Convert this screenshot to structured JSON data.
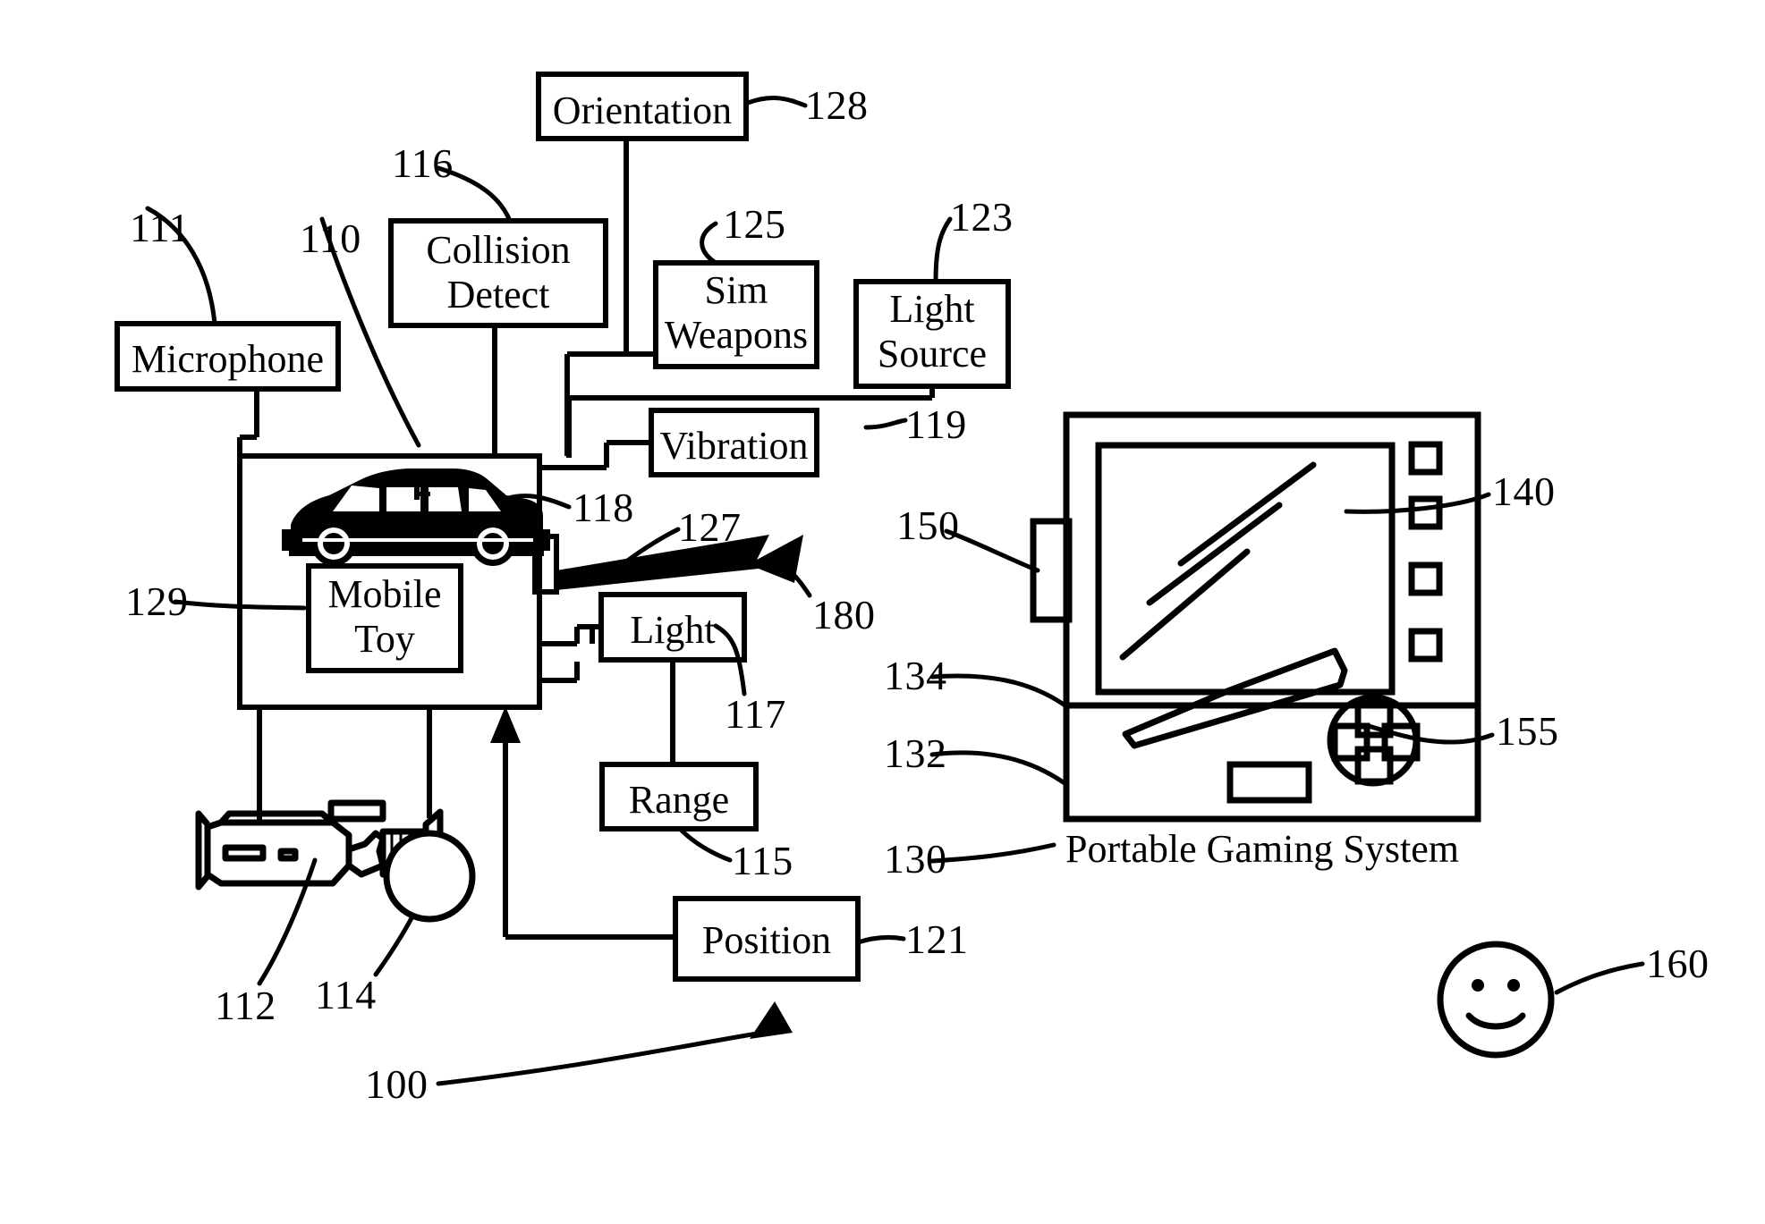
{
  "figure": {
    "title": "Mobile Toy and Portable Gaming System block diagram",
    "system_ref": "100",
    "caption": "Portable Gaming System",
    "line_color": "#000000",
    "background_color": "#ffffff"
  },
  "blocks": {
    "orientation": {
      "label": "Orientation",
      "ref": "128"
    },
    "collision_detect": {
      "label_line1": "Collision",
      "label_line2": "Detect",
      "ref": "116"
    },
    "sim_weapons": {
      "label_line1": "Sim",
      "label_line2": "Weapons",
      "ref": "125"
    },
    "light_source": {
      "label_line1": "Light",
      "label_line2": "Source",
      "ref": "123"
    },
    "microphone": {
      "label": "Microphone",
      "ref": "111"
    },
    "vibration": {
      "label": "Vibration",
      "ref": "119"
    },
    "light": {
      "label": "Light",
      "ref": "117"
    },
    "range": {
      "label": "Range",
      "ref": "115"
    },
    "position": {
      "label": "Position",
      "ref": "121"
    },
    "mobile_toy": {
      "label_line1": "Mobile",
      "label_line2": "Toy",
      "ref": "129"
    },
    "toy_enclosure": {
      "ref": "110"
    },
    "toy_transceiver": {
      "ref": "127"
    },
    "toy_car_icon": {
      "ref": "118"
    },
    "camera": {
      "ref": "112"
    },
    "speaker_sound": {
      "ref": "114"
    },
    "wireless_link": {
      "ref": "180"
    },
    "gaming_transceiver": {
      "ref": "150"
    },
    "gaming_buttons": {
      "ref": "140"
    },
    "gaming_dpad": {
      "ref": "155"
    },
    "gaming_display": {
      "ref": "134"
    },
    "gaming_lower_panel": {
      "ref": "132"
    },
    "gaming_system": {
      "ref": "130",
      "label": "Portable Gaming System"
    },
    "smiley_face": {
      "ref": "160"
    }
  },
  "refs": {
    "r100": "100",
    "r110": "110",
    "r111": "111",
    "r112": "112",
    "r114": "114",
    "r115": "115",
    "r116": "116",
    "r117": "117",
    "r118": "118",
    "r119": "119",
    "r121": "121",
    "r123": "123",
    "r125": "125",
    "r127": "127",
    "r128": "128",
    "r129": "129",
    "r130": "130",
    "r132": "132",
    "r134": "134",
    "r140": "140",
    "r150": "150",
    "r155": "155",
    "r160": "160",
    "r180": "180"
  }
}
